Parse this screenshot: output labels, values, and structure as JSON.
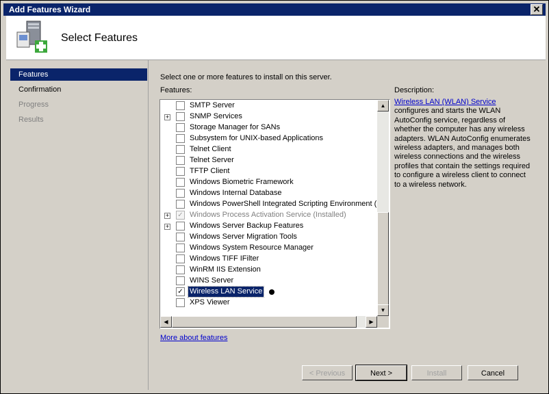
{
  "window": {
    "title": "Add Features Wizard",
    "close_glyph": "✕"
  },
  "header": {
    "title": "Select Features",
    "icon": "server-add-icon"
  },
  "nav": {
    "items": [
      {
        "label": "Features",
        "state": "active"
      },
      {
        "label": "Confirmation",
        "state": "normal"
      },
      {
        "label": "Progress",
        "state": "disabled"
      },
      {
        "label": "Results",
        "state": "disabled"
      }
    ]
  },
  "main": {
    "instruction": "Select one or more features to install on this server.",
    "features_label": "Features:",
    "description_label": "Description:",
    "features": [
      {
        "label": "SMTP Server",
        "expandable": false,
        "checked": false,
        "disabled": false
      },
      {
        "label": "SNMP Services",
        "expandable": true,
        "checked": false,
        "disabled": false
      },
      {
        "label": "Storage Manager for SANs",
        "expandable": false,
        "checked": false,
        "disabled": false
      },
      {
        "label": "Subsystem for UNIX-based Applications",
        "expandable": false,
        "checked": false,
        "disabled": false
      },
      {
        "label": "Telnet Client",
        "expandable": false,
        "checked": false,
        "disabled": false
      },
      {
        "label": "Telnet Server",
        "expandable": false,
        "checked": false,
        "disabled": false
      },
      {
        "label": "TFTP Client",
        "expandable": false,
        "checked": false,
        "disabled": false
      },
      {
        "label": "Windows Biometric Framework",
        "expandable": false,
        "checked": false,
        "disabled": false
      },
      {
        "label": "Windows Internal Database",
        "expandable": false,
        "checked": false,
        "disabled": false
      },
      {
        "label": "Windows PowerShell Integrated Scripting Environment (IS",
        "expandable": false,
        "checked": false,
        "disabled": false
      },
      {
        "label": "Windows Process Activation Service  (Installed)",
        "expandable": true,
        "checked": true,
        "disabled": true
      },
      {
        "label": "Windows Server Backup Features",
        "expandable": true,
        "checked": false,
        "disabled": false
      },
      {
        "label": "Windows Server Migration Tools",
        "expandable": false,
        "checked": false,
        "disabled": false
      },
      {
        "label": "Windows System Resource Manager",
        "expandable": false,
        "checked": false,
        "disabled": false
      },
      {
        "label": "Windows TIFF IFilter",
        "expandable": false,
        "checked": false,
        "disabled": false
      },
      {
        "label": "WinRM IIS Extension",
        "expandable": false,
        "checked": false,
        "disabled": false
      },
      {
        "label": "WINS Server",
        "expandable": false,
        "checked": false,
        "disabled": false
      },
      {
        "label": "Wireless LAN Service",
        "expandable": false,
        "checked": true,
        "disabled": false,
        "selected": true
      },
      {
        "label": "XPS Viewer",
        "expandable": false,
        "checked": false,
        "disabled": false
      }
    ],
    "description": {
      "link_text": "Wireless LAN (WLAN) Service ",
      "text": "configures and starts the WLAN AutoConfig service, regardless of whether the computer has any wireless adapters. WLAN AutoConfig enumerates wireless adapters, and manages both wireless connections and the wireless profiles that contain the settings required to configure a wireless client to connect to a wireless network."
    },
    "more_link": "More about features"
  },
  "buttons": {
    "previous": "< Previous",
    "next": "Next >",
    "install": "Install",
    "cancel": "Cancel"
  },
  "colors": {
    "accent": "#0a246a",
    "link": "#0000cc",
    "window_bg": "#d4d0c8"
  }
}
